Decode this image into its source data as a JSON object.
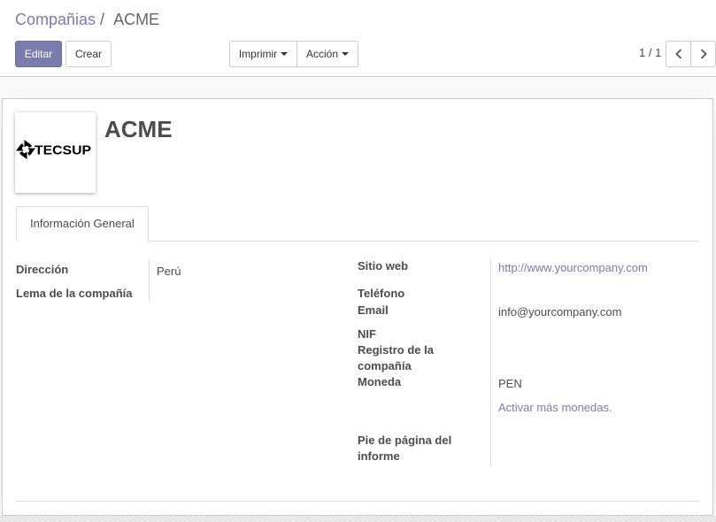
{
  "breadcrumb": {
    "parent": "Compañias",
    "separator": "/",
    "current": "ACME"
  },
  "toolbar": {
    "edit_label": "Editar",
    "create_label": "Crear",
    "print_label": "Imprimir",
    "action_label": "Acción"
  },
  "pager": {
    "value": "1 / 1",
    "prev_icon": "chevron-left-icon",
    "next_icon": "chevron-right-icon"
  },
  "record": {
    "name": "ACME",
    "logo_text": "TECSUP"
  },
  "tabs": [
    {
      "label": "Información General",
      "active": true
    }
  ],
  "form": {
    "left": [
      {
        "label": "Dirección",
        "value": "Perú"
      },
      {
        "label": "Lema de la compañía"
      }
    ],
    "right": [
      {
        "label": "Sitio web",
        "value": "http://www.yourcompany.com"
      },
      {
        "label": "Teléfono"
      },
      {
        "label": "Email",
        "value": "info@yourcompany.com"
      },
      {
        "label": "NIF"
      },
      {
        "label": "Registro de la compañía"
      },
      {
        "label": "Moneda",
        "value": "PEN"
      },
      {
        "label": "Pie de página del informe"
      }
    ],
    "currency_link": "Activar más monedas."
  },
  "colors": {
    "primary": "#7C7BAD",
    "text": "#4c4c4c",
    "border": "#cccccc"
  }
}
